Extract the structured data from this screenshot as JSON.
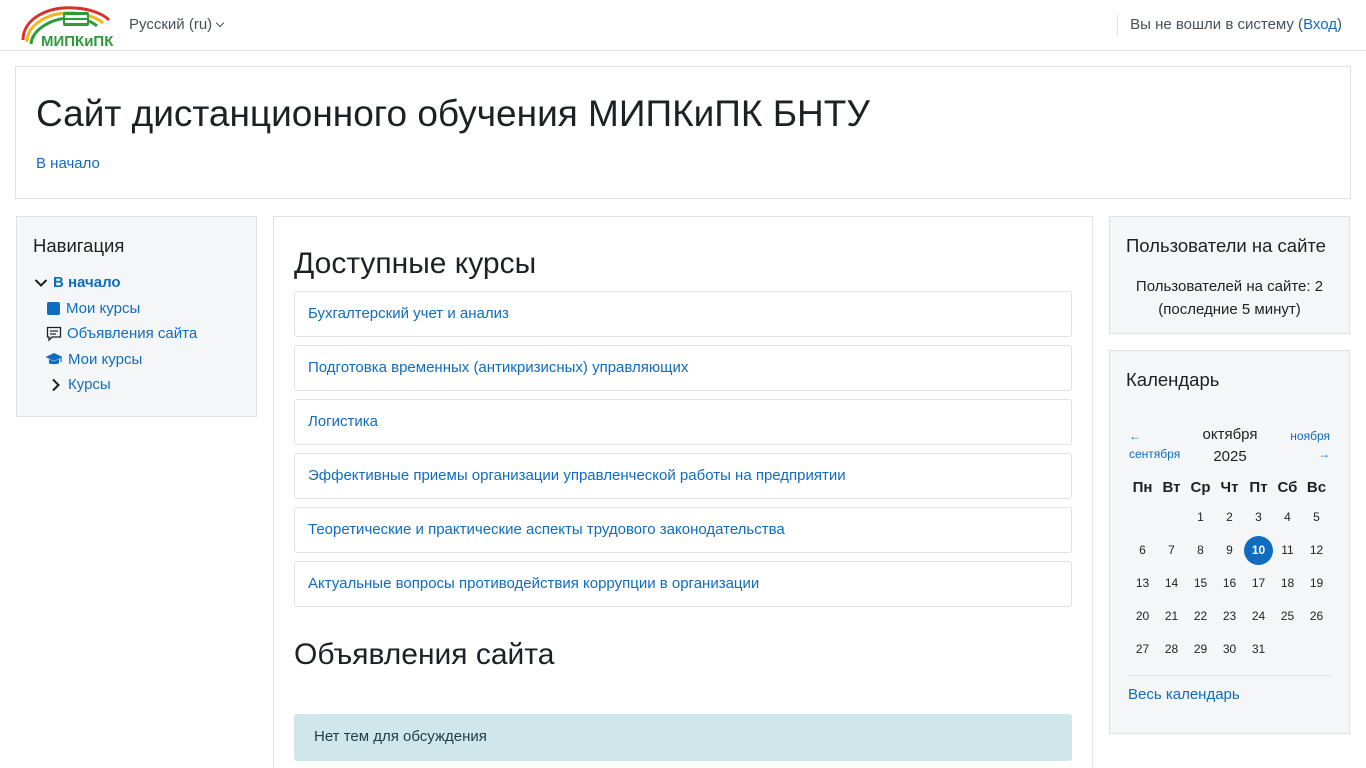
{
  "header": {
    "logo_text": "МИПКиПК",
    "language": "Русский (ru)",
    "login_prefix": "Вы не вошли в систему (",
    "login_link": "Вход",
    "login_suffix": ")"
  },
  "page": {
    "title": "Сайт дистанционного обучения МИПКиПК БНТУ",
    "breadcrumb": "В начало"
  },
  "navigation": {
    "title": "Навигация",
    "items": [
      {
        "label": "В начало",
        "icon": "chevron-down-icon"
      },
      {
        "label": "Мои курсы",
        "icon": "square-icon"
      },
      {
        "label": "Объявления сайта",
        "icon": "comment-icon"
      },
      {
        "label": "Мои курсы",
        "icon": "graduation-cap-icon"
      },
      {
        "label": "Курсы",
        "icon": "chevron-right-icon"
      }
    ]
  },
  "main": {
    "courses_heading": "Доступные курсы",
    "courses": [
      "Бухгалтерский учет и анализ",
      "Подготовка временных (антикризисных) управляющих",
      "Логистика",
      "Эффективные приемы организации управленческой работы на предприятии",
      "Теоретические и практические аспекты трудового законодательства",
      "Актуальные вопросы противодействия коррупции в организации"
    ],
    "news_heading": "Объявления сайта",
    "news_empty": "Нет тем для обсуждения"
  },
  "users_online": {
    "title": "Пользователи на сайте",
    "line1": "Пользователей на сайте: 2",
    "line2": "(последние 5 минут)"
  },
  "calendar": {
    "title": "Календарь",
    "prev_arrow": "←",
    "prev_month": "сентября",
    "next_month": "ноября",
    "next_arrow": "→",
    "month": "октября",
    "year": "2025",
    "weekdays": [
      "Пн",
      "Вт",
      "Ср",
      "Чт",
      "Пт",
      "Сб",
      "Вс"
    ],
    "weeks": [
      [
        "",
        "",
        "1",
        "2",
        "3",
        "4",
        "5"
      ],
      [
        "6",
        "7",
        "8",
        "9",
        "10",
        "11",
        "12"
      ],
      [
        "13",
        "14",
        "15",
        "16",
        "17",
        "18",
        "19"
      ],
      [
        "20",
        "21",
        "22",
        "23",
        "24",
        "25",
        "26"
      ],
      [
        "27",
        "28",
        "29",
        "30",
        "31",
        "",
        ""
      ]
    ],
    "today": "10",
    "full_link": "Весь календарь"
  },
  "colors": {
    "link": "#0f6cbf",
    "today_bg": "#0f6cbf",
    "alert_bg": "#cfe6ea",
    "block_bg": "#f5f6f7"
  }
}
